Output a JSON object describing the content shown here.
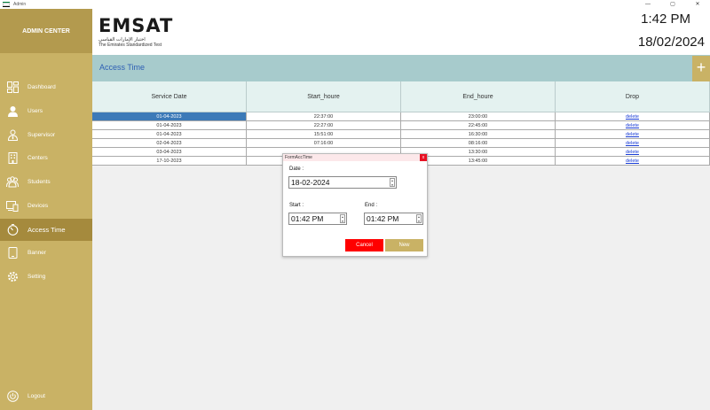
{
  "window": {
    "title": "Admin",
    "controls": [
      "—",
      "▢",
      "✕"
    ]
  },
  "sidebar": {
    "header": "ADMIN CENTER",
    "items": [
      {
        "label": "Dashboard",
        "icon": "dashboard-icon"
      },
      {
        "label": "Users",
        "icon": "user-icon"
      },
      {
        "label": "Supervisor",
        "icon": "supervisor-icon"
      },
      {
        "label": "Centers",
        "icon": "building-icon"
      },
      {
        "label": "Students",
        "icon": "students-icon"
      },
      {
        "label": "Devices",
        "icon": "devices-icon"
      },
      {
        "label": "Access Time",
        "icon": "timer-icon",
        "active": true
      },
      {
        "label": "Banner",
        "icon": "tablet-icon"
      },
      {
        "label": "Setting",
        "icon": "gear-icon"
      }
    ],
    "logout": "Logout"
  },
  "header": {
    "logo_text": "EMSAT",
    "logo_arabic": "اختبار الإمارات القياسي",
    "logo_sub": "The Emirates Standardized Test",
    "time": "1:42 PM",
    "date": "18/02/2024"
  },
  "section": {
    "title": "Access Time",
    "add_label": "+"
  },
  "table": {
    "columns": [
      "Service Date",
      "Start_houre",
      "End_houre",
      "Drop"
    ],
    "rows": [
      [
        "01-04-2023",
        "22:37:00",
        "23:00:00",
        "delete"
      ],
      [
        "01-04-2023",
        "22:27:00",
        "22:45:00",
        "delete"
      ],
      [
        "01-04-2023",
        "15:51:00",
        "16:30:00",
        "delete"
      ],
      [
        "02-04-2023",
        "07:16:00",
        "08:16:00",
        "delete"
      ],
      [
        "03-04-2023",
        "",
        "13:30:00",
        "delete"
      ],
      [
        "17-10-2023",
        "",
        "13:45:00",
        "delete"
      ]
    ]
  },
  "dialog": {
    "title": "FormAccTime",
    "close": "x",
    "date_label": "Date :",
    "date_value": "18-02-2024",
    "start_label": "Start :",
    "start_value": "01:42 PM",
    "end_label": "End :",
    "end_value": "01:42 PM",
    "cancel": "Cancel",
    "new": "New"
  },
  "colors": {
    "sidebar": "#c9b265",
    "sidebar_active": "#a58a3d",
    "section_bar": "#a7cbcc",
    "table_header": "#e4f2f0",
    "selection": "#3c7ab8",
    "cancel": "#ff0000"
  }
}
